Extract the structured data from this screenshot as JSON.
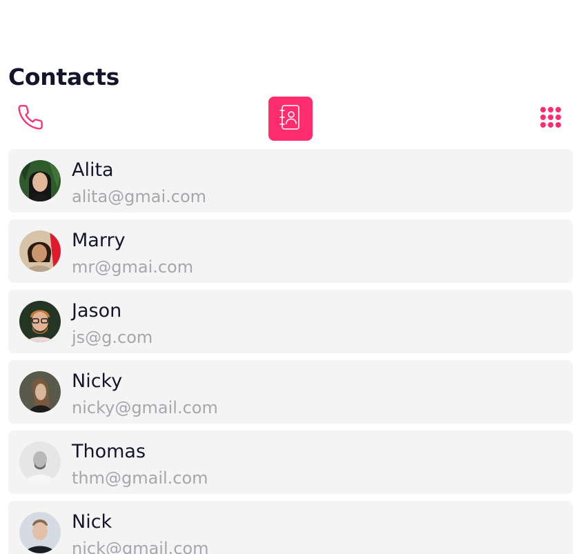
{
  "header": {
    "title": "Contacts"
  },
  "toolbar": {
    "buttons": [
      {
        "icon": "phone-icon",
        "active": false
      },
      {
        "icon": "address-book-icon",
        "active": true
      },
      {
        "icon": "grid-dots-icon",
        "active": false
      }
    ],
    "accent_color": "#ff2d6f"
  },
  "contacts": [
    {
      "name": "Alita",
      "email": "alita@gmai.com"
    },
    {
      "name": "Marry",
      "email": "mr@gmai.com"
    },
    {
      "name": "Jason",
      "email": "js@g.com"
    },
    {
      "name": "Nicky",
      "email": "nicky@gmail.com"
    },
    {
      "name": "Thomas",
      "email": "thm@gmail.com"
    },
    {
      "name": "Nick",
      "email": "nick@gmail.com"
    }
  ]
}
